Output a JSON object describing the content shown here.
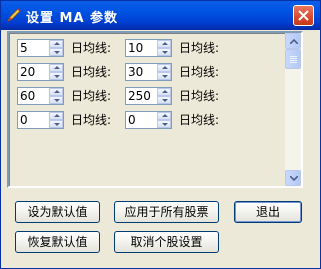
{
  "window": {
    "title": "设置 MA 参数",
    "title_color": "#ffffff",
    "title_bar_color": "#0054e3",
    "close_icon": "close-icon",
    "app_icon": "pen-icon"
  },
  "ma_settings": {
    "label": "日均线:",
    "rows": [
      {
        "left": "5",
        "right": "10"
      },
      {
        "left": "20",
        "right": "30"
      },
      {
        "left": "60",
        "right": "250"
      },
      {
        "left": "0",
        "right": "0"
      }
    ]
  },
  "buttons": {
    "set_default": "设为默认值",
    "apply_all": "应用于所有股票",
    "exit": "退出",
    "restore_default": "恢复默认值",
    "cancel_individual": "取消个股设置"
  },
  "scrollbar": {
    "up_icon": "chevron-up-icon",
    "down_icon": "chevron-down-icon"
  }
}
